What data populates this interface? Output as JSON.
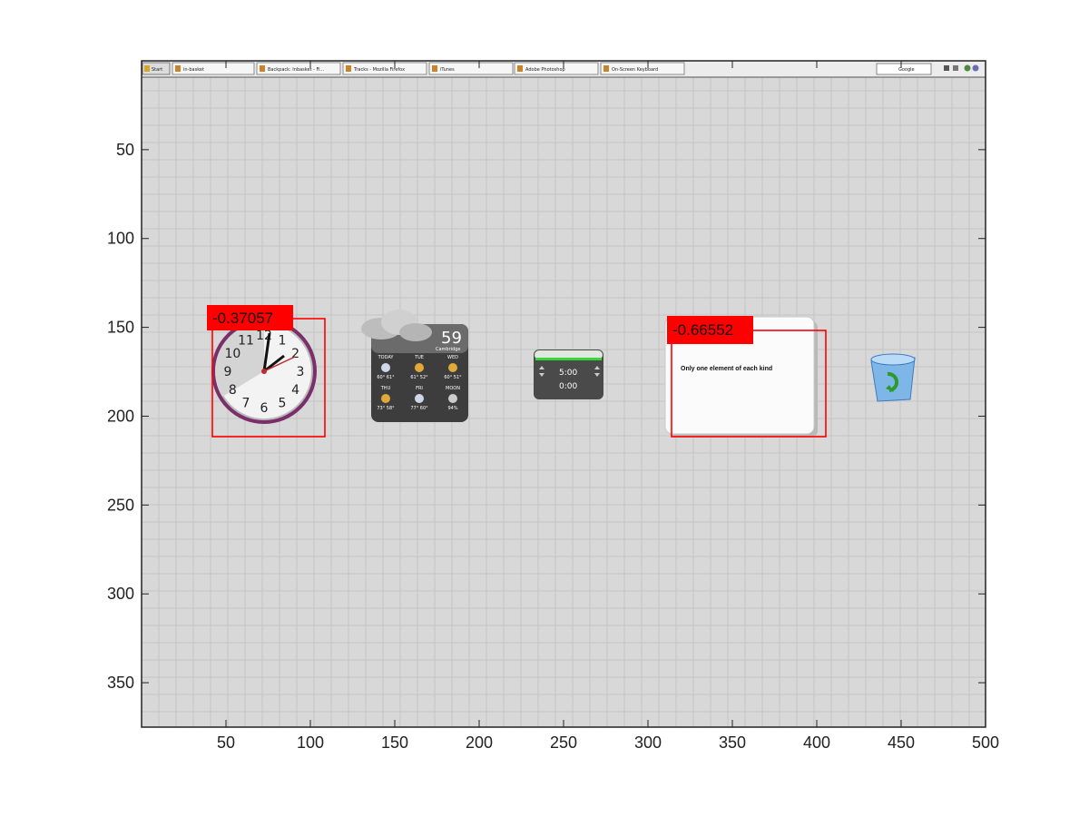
{
  "taskbar": {
    "start_label": "Start",
    "items": [
      {
        "label": "in-basket",
        "icon": "folder-icon"
      },
      {
        "label": "Backpack: Inbasket - Fi...",
        "icon": "firefox-icon"
      },
      {
        "label": "Tracks - Mozilla Firefox",
        "icon": "firefox-icon"
      },
      {
        "label": "iTunes",
        "icon": "itunes-icon"
      },
      {
        "label": "Adobe Photoshop",
        "icon": "photoshop-icon"
      },
      {
        "label": "On-Screen Keyboard",
        "icon": "keyboard-icon"
      }
    ],
    "search_placeholder": "Google",
    "tray_icons": [
      "minimize-icon",
      "close-icon",
      "tray-icon"
    ]
  },
  "widgets": {
    "clock": {
      "numbers": [
        "12",
        "1",
        "2",
        "3",
        "4",
        "5",
        "6",
        "7",
        "8",
        "9",
        "10",
        "11"
      ]
    },
    "weather": {
      "temp": "59",
      "city": "Cambridge",
      "days_row1": [
        "TODAY",
        "TUE",
        "WED"
      ],
      "temps_row1": [
        "60° 61°",
        "61° 52°",
        "60° 51°"
      ],
      "days_row2": [
        "THU",
        "FRI",
        "MOON"
      ],
      "temps_row2": [
        "73° 58°",
        "77° 60°",
        "94%"
      ]
    },
    "timer": {
      "line1": "5:00",
      "line2": "0:00"
    },
    "note": {
      "text": "Only one element of each kind"
    },
    "recycle_bin": {
      "icon": "recycle-bin-icon"
    }
  },
  "detections": [
    {
      "label": "-0.37057"
    },
    {
      "label": "-0.66552"
    }
  ],
  "axis": {
    "x_ticks": [
      "50",
      "100",
      "150",
      "200",
      "250",
      "300",
      "350",
      "400",
      "450",
      "500"
    ],
    "y_ticks": [
      "50",
      "100",
      "150",
      "200",
      "250",
      "300",
      "350"
    ]
  },
  "colors": {
    "box": "#ff0000",
    "label_bg": "#ff0000",
    "background": "#d6d6d6"
  }
}
